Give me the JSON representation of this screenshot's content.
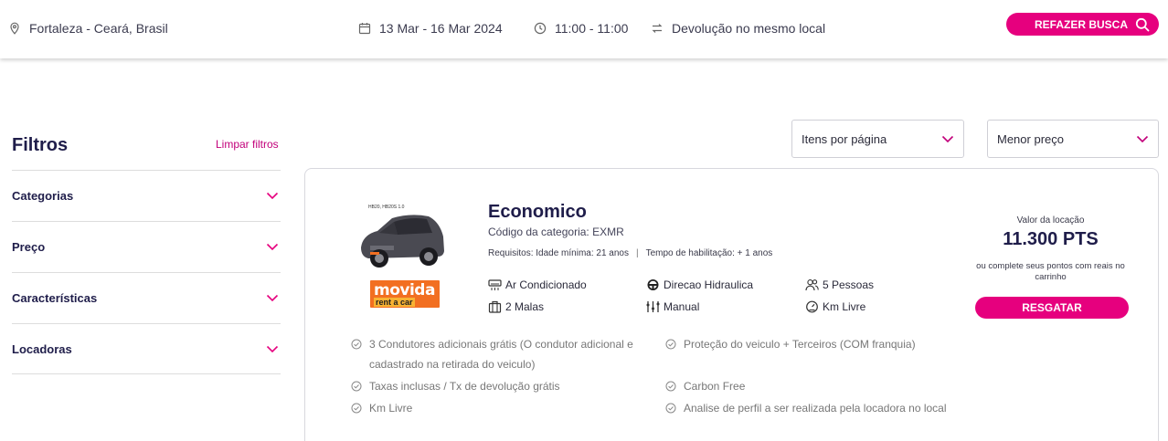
{
  "search": {
    "location": "Fortaleza - Ceará, Brasil",
    "dates": "13 Mar - 16 Mar 2024",
    "times": "11:00 - 11:00",
    "return": "Devolução no mesmo local",
    "button_label": "REFAZER BUSCA"
  },
  "filters": {
    "title": "Filtros",
    "clear_label": "Limpar filtros",
    "items": [
      "Categorias",
      "Preço",
      "Características",
      "Locadoras"
    ]
  },
  "sort": {
    "per_page": "Itens por página",
    "order": "Menor preço"
  },
  "offer": {
    "brand_logo_text": "movida",
    "brand_sub": "rent a car",
    "title": "Economico",
    "category_code": "Código da categoria: EXMR",
    "requirements": {
      "min_age": "Requisitos: Idade mínima: 21 anos",
      "separator": "|",
      "license": "Tempo de habilitação: + 1 anos"
    },
    "features": {
      "ac": "Ar Condicionado",
      "steering": "Direcao Hidraulica",
      "people": "5 Pessoas",
      "bags": "2 Malas",
      "gearbox": "Manual",
      "km": "Km Livre"
    },
    "benefits_left": [
      "3 Condutores adicionais grátis (O condutor adicional e cadastrado na retirada do veiculo)",
      "Taxas inclusas / Tx de devolução grátis",
      "Km Livre"
    ],
    "benefits_right": [
      "Proteção do veiculo + Terceiros (COM franquia)",
      "Carbon Free",
      "Analise de perfil a ser realizada pela locadora no local"
    ],
    "price_label": "Valor da locação",
    "price": "11.300 PTS",
    "price_note": "ou complete seus pontos com reais no carrinho",
    "redeem_label": "RESGATAR"
  },
  "colors": {
    "accent": "#e6007e",
    "title": "#1f1d4a",
    "brand_orange": "#f26f21"
  }
}
